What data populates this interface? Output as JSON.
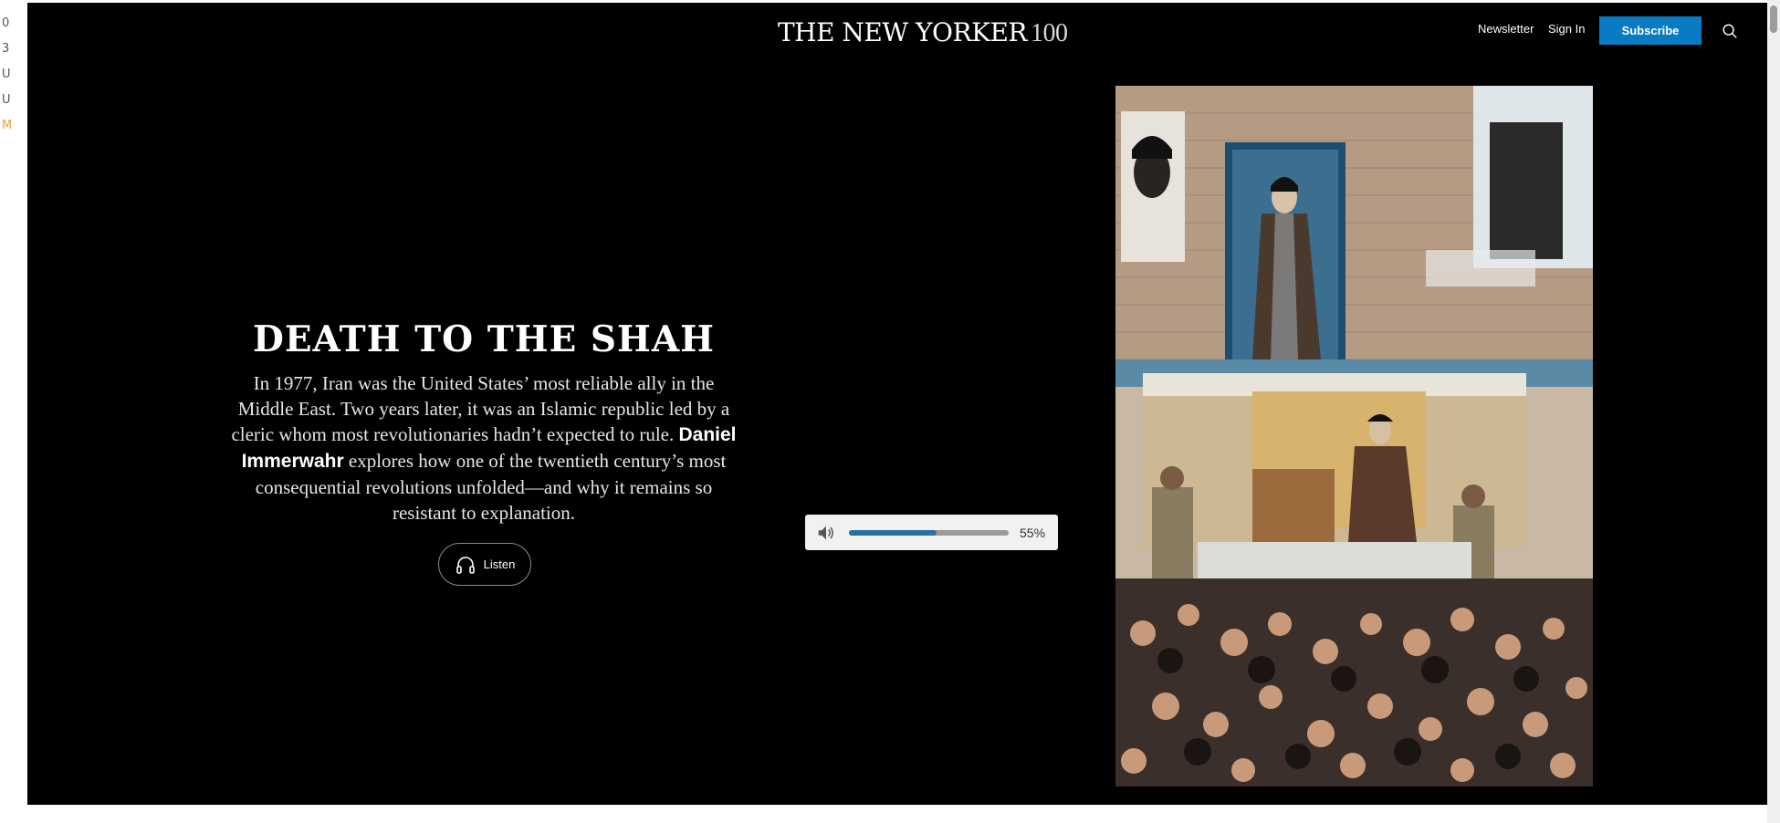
{
  "gutter": {
    "items": [
      "0",
      "3",
      "U",
      "U",
      "M"
    ]
  },
  "header": {
    "logo_text": "THE NEW YORKER",
    "logo_number": "100",
    "newsletter_label": "Newsletter",
    "signin_label": "Sign In",
    "subscribe_label": "Subscribe",
    "search_icon": "search-icon"
  },
  "hero": {
    "headline": "DEATH TO THE SHAH",
    "dek_before": "In 1977, Iran was the United States’ most reliable ally in the Middle East. Two years later, it was an Islamic republic led by a cleric whom most revolutionaries hadn’t expected to rule. ",
    "author": "Daniel Immerwahr",
    "dek_after": " explores how one of the twentieth century’s most consequential revolutions unfolded—and why it remains so resistant to explanation.",
    "listen_label": "Listen",
    "listen_icon": "headphones-icon"
  },
  "volume": {
    "level": 0.55,
    "percent_label": "55%",
    "icon": "speaker-icon",
    "fill_color": "#2b6fa3"
  },
  "colors": {
    "accent": "#0a7bc2",
    "background": "#000000"
  }
}
